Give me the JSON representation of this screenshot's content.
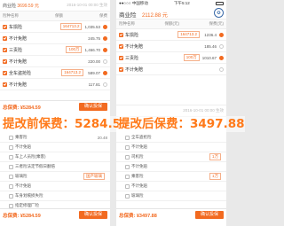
{
  "left": {
    "header": {
      "title": "商业险",
      "price": "3699.59 元",
      "date": "2016-10-01 00:00 生效"
    },
    "columns": {
      "name": "险种名称",
      "amount": "保额",
      "premium": "保费"
    },
    "rows": [
      {
        "name": "车损险",
        "amount": "164713.2",
        "premium": "1,035.53",
        "checked": true,
        "radio": true
      },
      {
        "name": "不计免赔",
        "amount": "",
        "premium": "245.75",
        "checked": true,
        "radio": true
      },
      {
        "name": "三责险",
        "amount": "100万",
        "premium": "1,466.70",
        "checked": true,
        "radio": true
      },
      {
        "name": "不计免赔",
        "amount": "",
        "premium": "220.00",
        "checked": true,
        "radio": false
      },
      {
        "name": "全车盗抢险",
        "amount": "164713.2",
        "premium": "589.07",
        "checked": true,
        "radio": true
      },
      {
        "name": "不计免赔",
        "amount": "",
        "premium": "117.81",
        "checked": true,
        "radio": false
      }
    ],
    "footer_top": {
      "total": "总保费: ¥5284.59",
      "buy": "确认投保"
    },
    "sub_rows": [
      {
        "name": "乘客险",
        "premium": "20.48"
      },
      {
        "name": "不计免赔",
        "premium": ""
      },
      {
        "name": "车上人员险(乘客)",
        "premium": ""
      },
      {
        "name": "三者险法定节假日翻倍",
        "premium": ""
      },
      {
        "name": "玻璃险",
        "amount": "国产玻璃",
        "premium": ""
      },
      {
        "name": "不计免赔",
        "premium": ""
      },
      {
        "name": "车身划痕损失险",
        "premium": ""
      },
      {
        "name": "指定修理厂险",
        "premium": ""
      },
      {
        "name": "车损险无法找到第三方",
        "premium": ""
      }
    ],
    "footer": {
      "total": "总保费: ¥5284.59",
      "buy": "确认投保"
    },
    "caption": "提改前保费：5284.59"
  },
  "right": {
    "phone_status": {
      "carrier": "●●○○○ 中国移动",
      "time": "下午5:12"
    },
    "header": {
      "title": "商业险",
      "price": "2112.88 元",
      "date": "2016-10-01 00:00 生效"
    },
    "columns": {
      "name": "险种名称",
      "amount": "保额(元)",
      "premium": "保费(元)"
    },
    "rows": [
      {
        "name": "车损险",
        "amount": "164713.2",
        "premium": "1236.4",
        "checked": true,
        "radio": true
      },
      {
        "name": "不计免赔",
        "amount": "",
        "premium": "185.46",
        "checked": true,
        "radio": false
      },
      {
        "name": "三责险",
        "amount": "100万",
        "premium": "1010.67",
        "checked": true,
        "radio": true
      },
      {
        "name": "不计免赔",
        "amount": "",
        "premium": "",
        "checked": true,
        "radio": false
      }
    ],
    "date2": "2016-10-01 00:00 生效",
    "sub_rows": [
      {
        "name": "全车盗抢险",
        "premium": ""
      },
      {
        "name": "不计免赔",
        "premium": ""
      },
      {
        "name": "司机险",
        "amount": "1万",
        "premium": ""
      },
      {
        "name": "不计免赔",
        "premium": ""
      },
      {
        "name": "乘客险",
        "amount": "1万",
        "premium": ""
      },
      {
        "name": "不计免赔",
        "premium": ""
      },
      {
        "name": "玻璃险",
        "premium": ""
      }
    ],
    "footer": {
      "total": "总保费: ¥3497.88",
      "buy": "确认投保"
    },
    "caption": "提改后保费：3497.88"
  },
  "colors": {
    "accent": "#f26a20",
    "caption": "#ff7a1a"
  },
  "icons": {
    "checkbox": "checkbox-checked-icon",
    "radio": "radio-selected-icon",
    "seal": "logo-seal-icon"
  }
}
